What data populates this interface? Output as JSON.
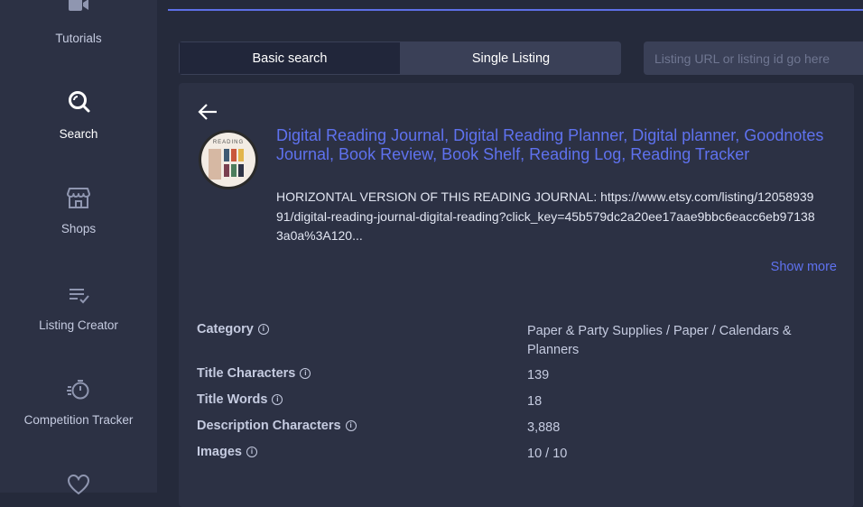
{
  "sidebar": {
    "items": [
      {
        "label": "Tutorials",
        "icon": "video-camera-icon",
        "active": false
      },
      {
        "label": "Search",
        "icon": "search-icon",
        "active": true
      },
      {
        "label": "Shops",
        "icon": "shop-icon",
        "active": false
      },
      {
        "label": "Listing Creator",
        "icon": "list-check-icon",
        "active": false
      },
      {
        "label": "Competition Tracker",
        "icon": "stopwatch-icon",
        "active": false
      },
      {
        "label": "",
        "icon": "heart-icon",
        "active": false
      }
    ]
  },
  "tabs": [
    {
      "label": "Basic search",
      "active": true
    },
    {
      "label": "Single Listing",
      "active": false
    }
  ],
  "search": {
    "placeholder": "Listing URL or listing id go here",
    "value": ""
  },
  "listing": {
    "title": "Digital Reading Journal, Digital Reading Planner, Digital planner, Goodnotes Journal, Book Review, Book Shelf, Reading Log, Reading Tracker",
    "description": "HORIZONTAL VERSION OF THIS READING JOURNAL: https://www.etsy.com/listing/1205893991/digital-reading-journal-digital-reading?click_key=45b579dc2a20ee17aae9bbc6eacc6eb971383a0a%3A120...",
    "show_more": "Show more",
    "thumbnail_text": "READING"
  },
  "details": [
    {
      "label": "Category",
      "value": "Paper & Party Supplies / Paper / Calendars & Planners"
    },
    {
      "label": "Title Characters",
      "value": "139"
    },
    {
      "label": "Title Words",
      "value": "18"
    },
    {
      "label": "Description Characters",
      "value": "3,888"
    },
    {
      "label": "Images",
      "value": "10 / 10"
    }
  ],
  "colors": {
    "accent": "#5f72ef",
    "background": "#252a3b",
    "panel": "#2c3144"
  }
}
